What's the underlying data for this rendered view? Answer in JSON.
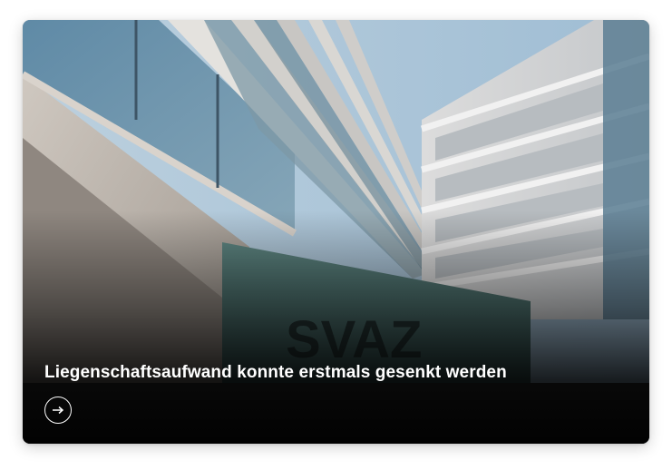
{
  "card": {
    "image": {
      "signage_text": "SVAZ",
      "alt_description_icon": "building-photo"
    },
    "title": "Liegenschaftsaufwand konnte erstmals gesenkt werden",
    "button_icon": "arrow-right-icon"
  }
}
